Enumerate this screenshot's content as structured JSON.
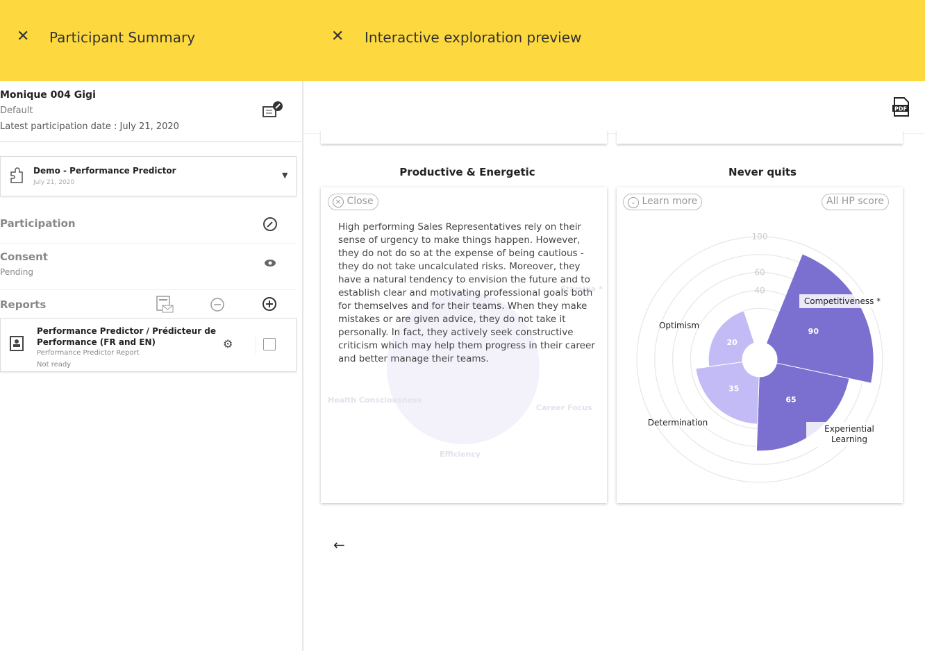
{
  "topbar": {
    "left_title": "Participant Summary",
    "right_title": "Interactive exploration preview",
    "close_icon": "close-icon"
  },
  "participant": {
    "name": "Monique 004 Gigi",
    "group": "Default",
    "latest_date": "Latest participation date : July 21, 2020"
  },
  "assessment": {
    "title": "Demo - Performance Predictor",
    "date": "July 21, 2020"
  },
  "sections": {
    "participation": "Participation",
    "consent": "Consent",
    "consent_status": "Pending",
    "reports": "Reports"
  },
  "report": {
    "title": "Performance Predictor / Prédicteur de Performance (FR and EN)",
    "subtitle": "Performance Predictor Report",
    "status": "Not ready"
  },
  "cards": [
    {
      "title": "Productive & Energetic",
      "close_label": "Close",
      "description": "High performing Sales Representatives rely on their sense of urgency to make things happen. However, they do not do so at the expense of being cautious - they do not take uncalculated risks. Moreover, they have a natural tendency to envision the future and to establish clear and motivating professional goals both for themselves and for their teams. When they make mistakes or are given advice, they do not take it personally. In fact, they actively seek constructive criticism which may help them progress in their career and better manage their teams.",
      "background_labels": [
        "Stamina *",
        "Health Consciousness",
        "Career Focus",
        "Efficiency"
      ]
    },
    {
      "title": "Never quits",
      "learn_more": "Learn more",
      "all_hp": "All HP score"
    }
  ],
  "chart_data": {
    "type": "polar-bar",
    "categories": [
      "Competitiveness *",
      "Experiential Learning",
      "Determination",
      "Optimism"
    ],
    "values": [
      90,
      65,
      35,
      20
    ],
    "colors": [
      "#7b6fd0",
      "#7b6fd0",
      "#c2bbf6",
      "#c2bbf6"
    ],
    "radial_ticks": [
      40,
      60,
      100
    ],
    "rlim": [
      0,
      100
    ]
  }
}
